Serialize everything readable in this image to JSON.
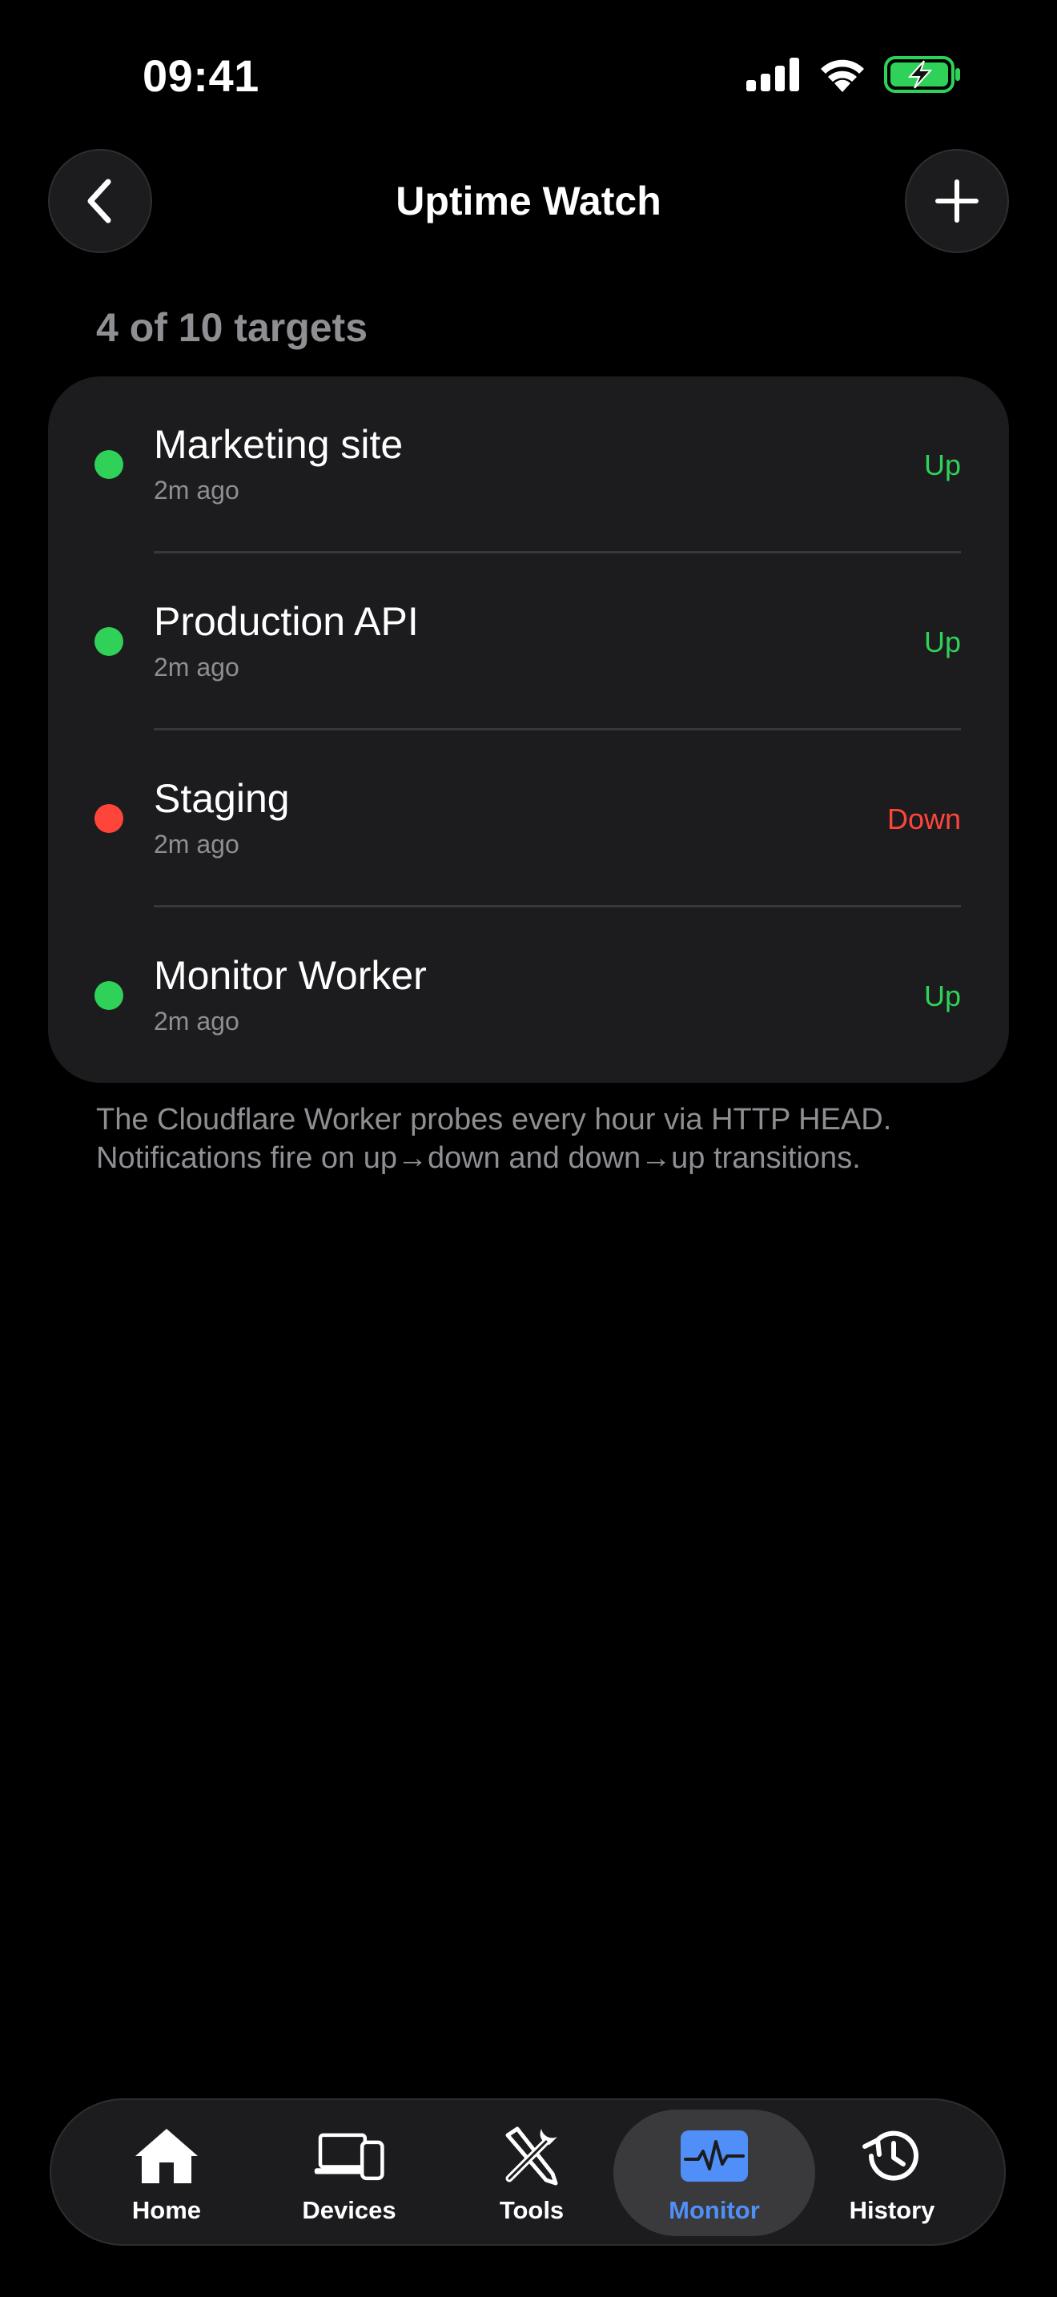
{
  "status_bar": {
    "time": "09:41"
  },
  "header": {
    "title": "Uptime Watch",
    "back_icon": "chevron-left-icon",
    "add_icon": "plus-icon"
  },
  "summary": {
    "count_label": "4 of 10 targets"
  },
  "targets": [
    {
      "name": "Marketing site",
      "checked": "2m ago",
      "status": "Up",
      "state": "up"
    },
    {
      "name": "Production API",
      "checked": "2m ago",
      "status": "Up",
      "state": "up"
    },
    {
      "name": "Staging",
      "checked": "2m ago",
      "status": "Down",
      "state": "down"
    },
    {
      "name": "Monitor Worker",
      "checked": "2m ago",
      "status": "Up",
      "state": "up"
    }
  ],
  "footnote": "The Cloudflare Worker probes every hour via HTTP HEAD. Notifications fire on up→down and down→up transitions.",
  "tabs": [
    {
      "label": "Home",
      "icon": "house-icon",
      "active": false
    },
    {
      "label": "Devices",
      "icon": "devices-icon",
      "active": false
    },
    {
      "label": "Tools",
      "icon": "tools-icon",
      "active": false
    },
    {
      "label": "Monitor",
      "icon": "waveform-icon",
      "active": true
    },
    {
      "label": "History",
      "icon": "history-icon",
      "active": false
    }
  ],
  "colors": {
    "up": "#30d158",
    "down": "#ff453a",
    "accent": "#4f8ff7",
    "card": "#1c1c1e",
    "secondary_text": "#8e8e93",
    "battery": "#30d158"
  }
}
